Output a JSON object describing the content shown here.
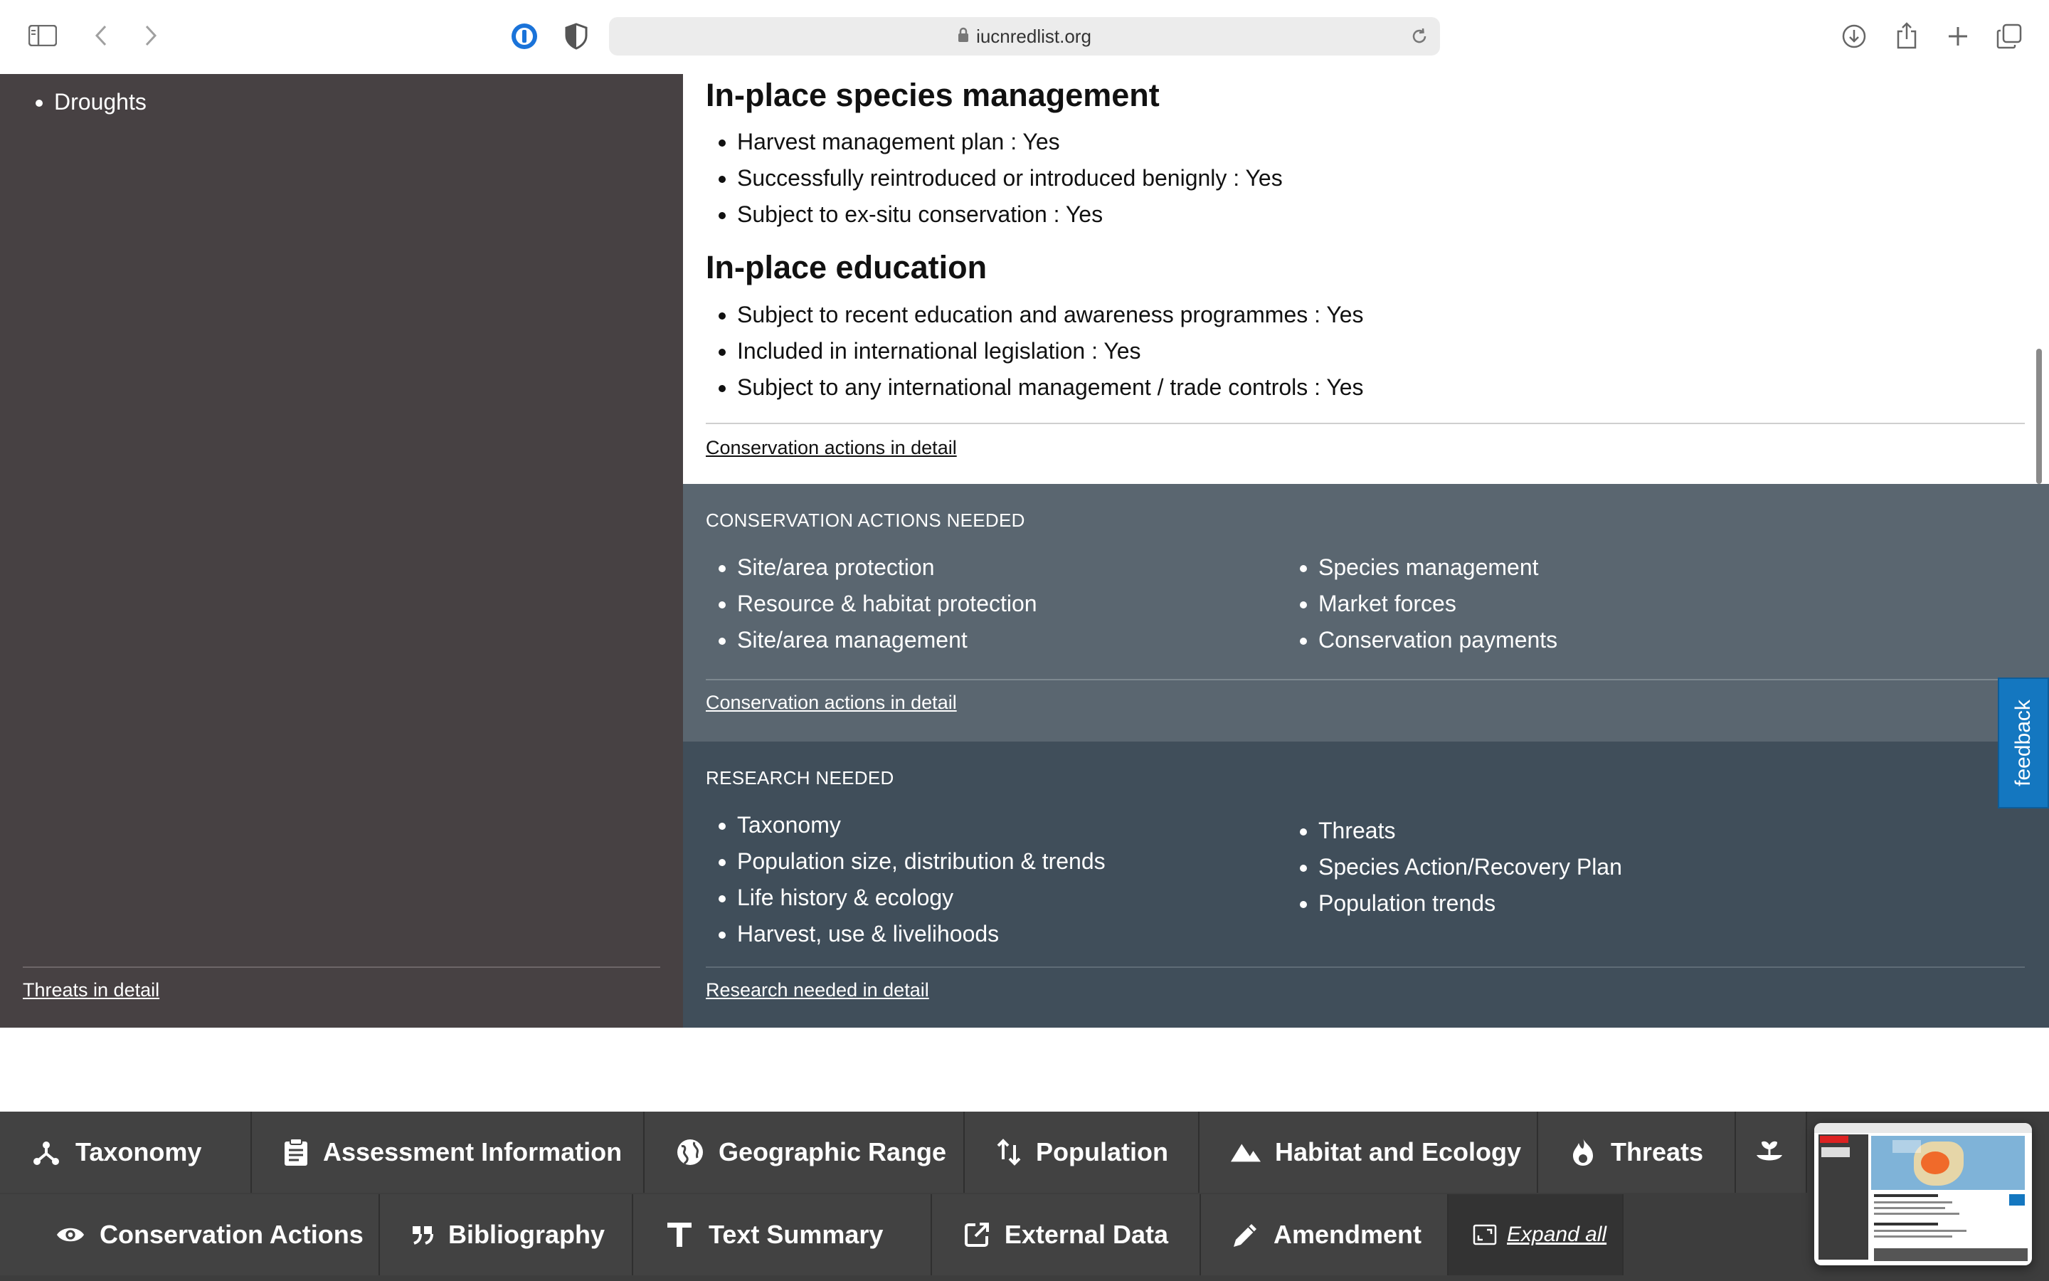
{
  "browser": {
    "url": "iucnredlist.org"
  },
  "sidebar": {
    "items": [
      "Droughts"
    ],
    "link": "Threats in detail"
  },
  "main": {
    "species_management": {
      "heading": "In-place species management",
      "items": [
        "Harvest management plan : Yes",
        "Successfully reintroduced or introduced benignly : Yes",
        "Subject to ex-situ conservation : Yes"
      ]
    },
    "education": {
      "heading": "In-place education",
      "items": [
        "Subject to recent education and awareness programmes : Yes",
        "Included in international legislation : Yes",
        "Subject to any international management / trade controls : Yes"
      ]
    },
    "link": "Conservation actions in detail"
  },
  "actions_needed": {
    "title": "CONSERVATION ACTIONS NEEDED",
    "col1": [
      "Site/area protection",
      "Resource & habitat protection",
      "Site/area management"
    ],
    "col2": [
      "Species management",
      "Market forces",
      "Conservation payments"
    ],
    "link": "Conservation actions in detail"
  },
  "research_needed": {
    "title": "RESEARCH NEEDED",
    "col1": [
      "Taxonomy",
      "Population size, distribution & trends",
      "Life history & ecology",
      "Harvest, use & livelihoods"
    ],
    "col2": [
      "Threats",
      "Species Action/Recovery Plan",
      "Population trends"
    ],
    "link": "Research needed in detail"
  },
  "feedback": "feedback",
  "nav": {
    "row1": [
      {
        "label": "Taxonomy",
        "icon": "taxonomy-icon"
      },
      {
        "label": "Assessment Information",
        "icon": "clipboard-icon"
      },
      {
        "label": "Geographic Range",
        "icon": "globe-icon"
      },
      {
        "label": "Population",
        "icon": "population-arrows-icon"
      },
      {
        "label": "Habitat and Ecology",
        "icon": "mountain-icon"
      },
      {
        "label": "Threats",
        "icon": "flame-icon"
      }
    ],
    "row2": [
      {
        "label": "Conservation Actions",
        "icon": "eye-icon"
      },
      {
        "label": "Bibliography",
        "icon": "quote-icon"
      },
      {
        "label": "Text Summary",
        "icon": "text-icon"
      },
      {
        "label": "External Data",
        "icon": "external-link-icon"
      },
      {
        "label": "Amendment",
        "icon": "pencil-icon"
      }
    ],
    "expand": "Expand all"
  },
  "colors": {
    "sidebar_bg": "#474143",
    "actions_bg": "#5a6670",
    "research_bg": "#404e5a",
    "nav_bg": "#424242",
    "feedback_bg": "#1477c0"
  }
}
